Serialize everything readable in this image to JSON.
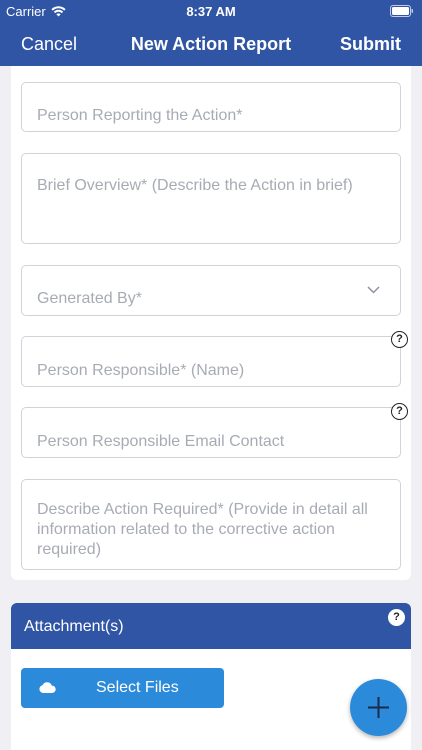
{
  "status": {
    "carrier": "Carrier",
    "time": "8:37 AM"
  },
  "nav": {
    "cancel_label": "Cancel",
    "title": "New Action Report",
    "submit_label": "Submit"
  },
  "form": {
    "person_reporting_placeholder": "Person Reporting the Action*",
    "brief_overview_placeholder": "Brief Overview* (Describe the Action in brief)",
    "generated_by_placeholder": "Generated By*",
    "person_responsible_placeholder": "Person Responsible* (Name)",
    "person_email_placeholder": "Person Responsible Email Contact",
    "action_required_placeholder": "Describe Action Required* (Provide in detail all information related to the corrective action required)",
    "help_glyph": "?"
  },
  "attachments": {
    "title": "Attachment(s)",
    "select_files_label": "Select Files",
    "help_glyph": "?"
  },
  "colors": {
    "primary": "#2f55a4",
    "accent": "#2b8ad9",
    "placeholder": "#a7abb3"
  }
}
